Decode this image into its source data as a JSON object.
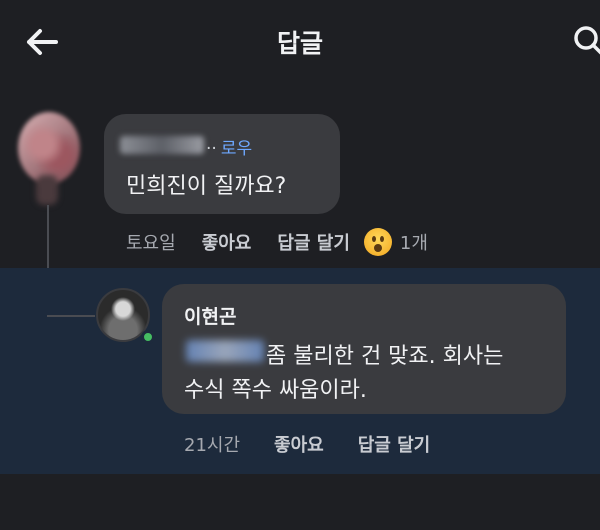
{
  "header": {
    "title": "답글",
    "back_icon": "arrow-left-icon",
    "search_icon": "search-icon"
  },
  "comments": [
    {
      "author": "로우",
      "author_prefix": "··",
      "text": "민희진이 질까요?",
      "time": "토요일",
      "like_label": "좋아요",
      "reply_label": "답글 달기",
      "reaction_icon": "surprised-face-emoji-icon",
      "reaction_count": "1개"
    },
    {
      "author": "이현곤",
      "text_line1": "좀 불리한 건 맞죠. 회사는",
      "text_line2": "수식 쪽수 싸움이라.",
      "time": "21시간",
      "like_label": "좋아요",
      "reply_label": "답글 달기",
      "online": true
    }
  ],
  "colors": {
    "background": "#1e1f23",
    "highlight": "#1d2a3c",
    "bubble": "#3a3b3f",
    "link_blue": "#6ea8ff",
    "online_green": "#45bd62"
  }
}
